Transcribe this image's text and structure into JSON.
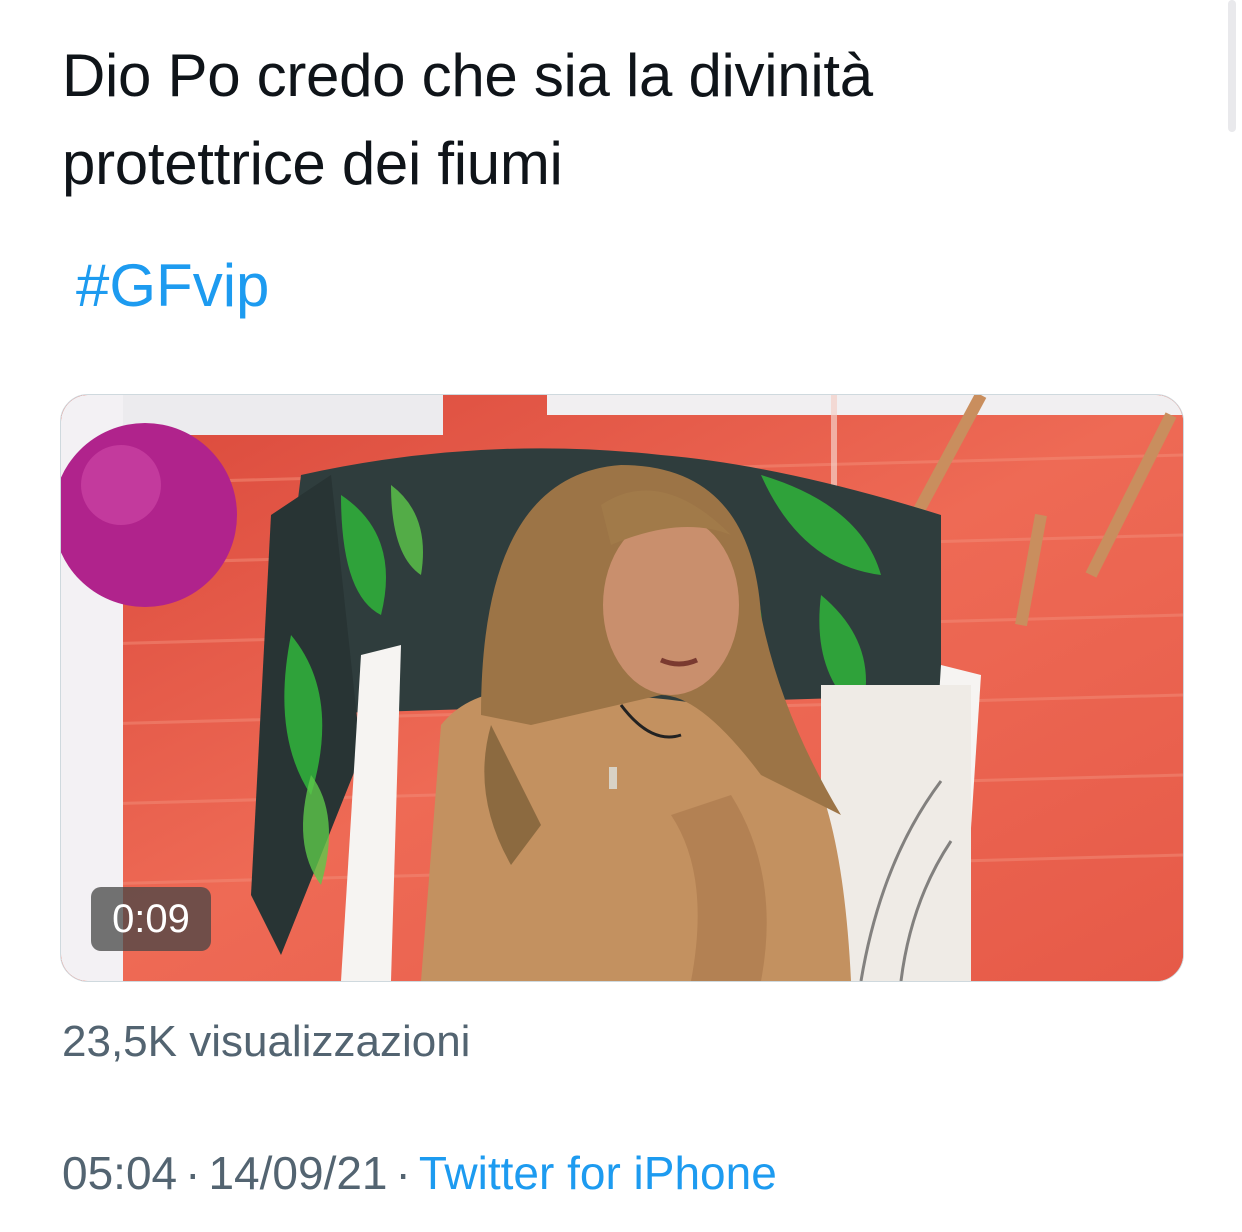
{
  "tweet": {
    "text_line1": "Dio Po credo che sia la divinità",
    "text_line2": "protettrice dei fiumi",
    "hashtag": "#GFvip"
  },
  "media": {
    "type": "video",
    "duration": "0:09",
    "views": "23,5K visualizzazioni"
  },
  "meta": {
    "time": "05:04",
    "separator": "·",
    "date": "14/09/21",
    "source": "Twitter for iPhone"
  },
  "colors": {
    "text": "#0f1419",
    "secondary": "#536471",
    "link": "#1d9bf0"
  }
}
